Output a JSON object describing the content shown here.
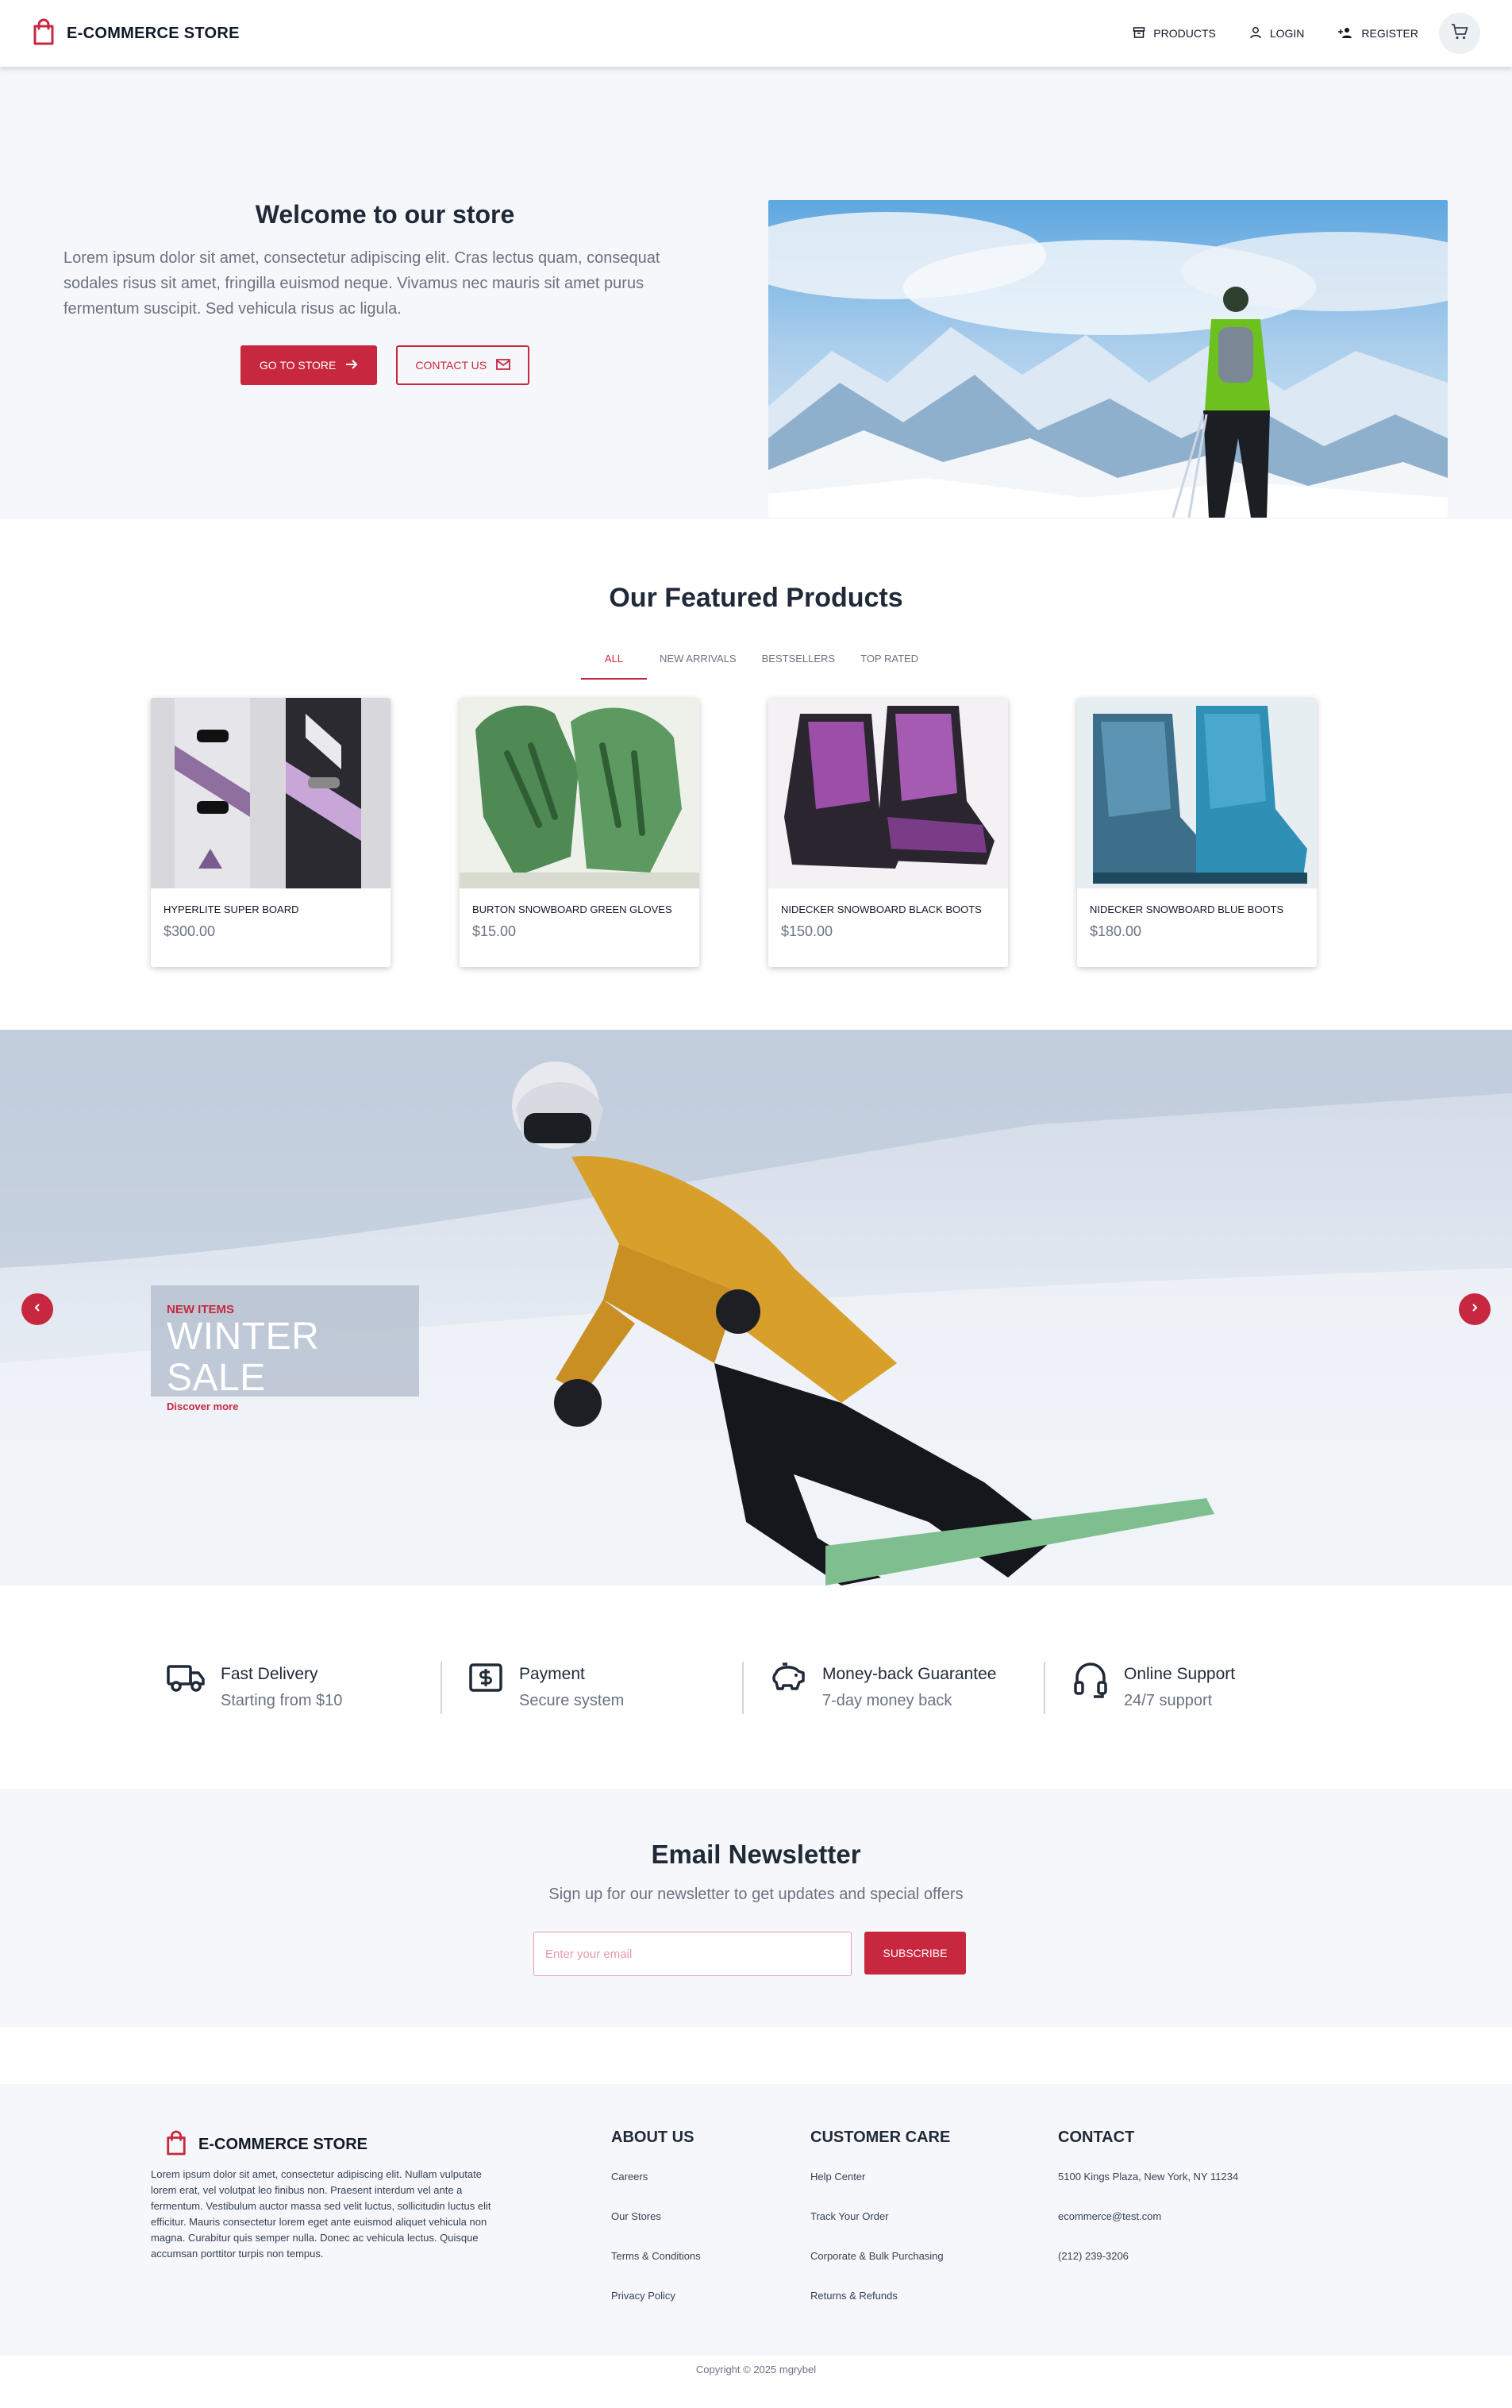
{
  "header": {
    "brand": "E-COMMERCE STORE",
    "nav": [
      {
        "label": "PRODUCTS",
        "icon": "box-icon"
      },
      {
        "label": "LOGIN",
        "icon": "user-icon"
      },
      {
        "label": "REGISTER",
        "icon": "user-plus-icon"
      }
    ],
    "cart_icon": "cart-icon"
  },
  "hero": {
    "title": "Welcome to our store",
    "text": "Lorem ipsum dolor sit amet, consectetur adipiscing elit. Cras lectus quam, consequat sodales risus sit amet, fringilla euismod neque. Vivamus nec mauris sit amet purus fermentum suscipit. Sed vehicula risus ac ligula.",
    "primary_button": "GO TO STORE",
    "secondary_button": "CONTACT US"
  },
  "featured": {
    "title": "Our Featured Products",
    "tabs": [
      "ALL",
      "NEW ARRIVALS",
      "BESTSELLERS",
      "TOP RATED"
    ],
    "active_tab": "ALL",
    "products": [
      {
        "name": "HYPERLITE SUPER BOARD",
        "price": "$300.00"
      },
      {
        "name": "BURTON SNOWBOARD GREEN GLOVES",
        "price": "$15.00"
      },
      {
        "name": "NIDECKER SNOWBOARD BLACK BOOTS",
        "price": "$150.00"
      },
      {
        "name": "NIDECKER SNOWBOARD BLUE BOOTS",
        "price": "$180.00"
      }
    ]
  },
  "banner": {
    "eyebrow": "NEW ITEMS",
    "title": "WINTER SALE",
    "link": "Discover more"
  },
  "features": [
    {
      "title": "Fast Delivery",
      "subtitle": "Starting from $10",
      "icon": "truck-icon"
    },
    {
      "title": "Payment",
      "subtitle": "Secure system",
      "icon": "dollar-icon"
    },
    {
      "title": "Money-back Guarantee",
      "subtitle": "7-day money back",
      "icon": "piggy-bank-icon"
    },
    {
      "title": "Online Support",
      "subtitle": "24/7 support",
      "icon": "headset-icon"
    }
  ],
  "newsletter": {
    "title": "Email Newsletter",
    "subtitle": "Sign up for our newsletter to get updates and special offers",
    "placeholder": "Enter your email",
    "button": "SUBSCRIBE"
  },
  "footer": {
    "brand": "E-COMMERCE STORE",
    "description": "Lorem ipsum dolor sit amet, consectetur adipiscing elit. Nullam vulputate lorem erat, vel volutpat leo finibus non. Praesent interdum vel ante a fermentum. Vestibulum auctor massa sed velit luctus, sollicitudin luctus elit efficitur. Mauris consectetur lorem eget ante euismod aliquet vehicula non magna. Curabitur quis semper nulla. Donec ac vehicula lectus. Quisque accumsan porttitor turpis non tempus.",
    "columns": [
      {
        "title": "ABOUT US",
        "links": [
          "Careers",
          "Our Stores",
          "Terms & Conditions",
          "Privacy Policy"
        ]
      },
      {
        "title": "CUSTOMER CARE",
        "links": [
          "Help Center",
          "Track Your Order",
          "Corporate & Bulk Purchasing",
          "Returns & Refunds"
        ]
      },
      {
        "title": "CONTACT",
        "links": [
          "5100 Kings Plaza, New York, NY 11234",
          "ecommerce@test.com",
          "(212) 239-3206"
        ]
      }
    ],
    "copyright": "Copyright © 2025 mgrybel"
  },
  "colors": {
    "accent": "#c8283f",
    "text": "#1f2937",
    "muted": "#6b7280",
    "section_bg": "#f5f7fa"
  }
}
